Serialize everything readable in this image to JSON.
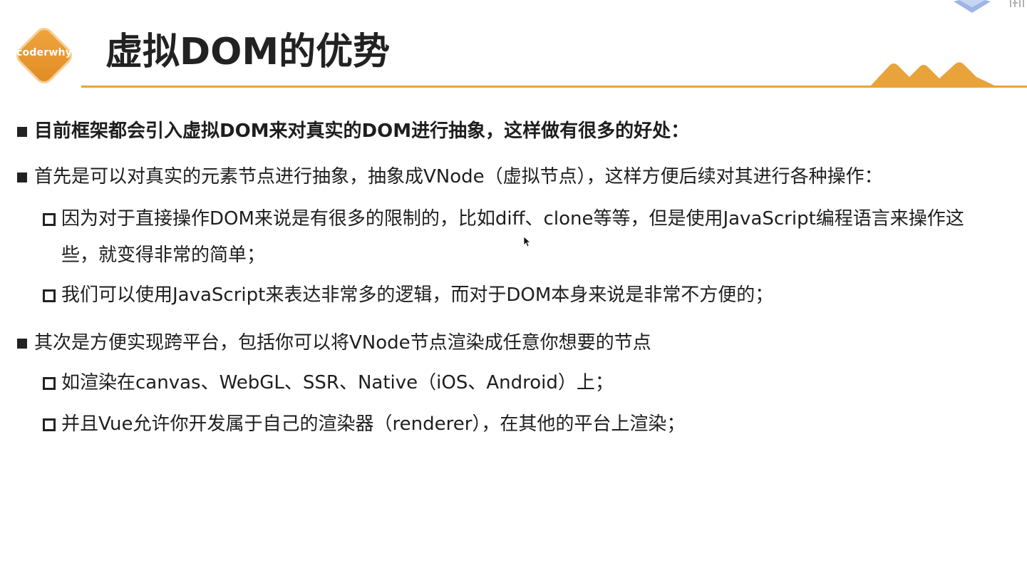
{
  "logo": {
    "text": "coderwhy",
    "color": "#e8962e"
  },
  "title": "虚拟DOM的优势",
  "accent_color": "#e8a33b",
  "bullets": [
    {
      "level": 1,
      "bold": true,
      "text": "目前框架都会引入虚拟DOM来对真实的DOM进行抽象，这样做有很多的好处："
    },
    {
      "level": 1,
      "bold": false,
      "text": "首先是可以对真实的元素节点进行抽象，抽象成VNode（虚拟节点），这样方便后续对其进行各种操作："
    },
    {
      "level": 2,
      "bold": false,
      "text": "因为对于直接操作DOM来说是有很多的限制的，比如diff、clone等等，但是使用JavaScript编程语言来操作这",
      "continuation": "些，就变得非常的简单；"
    },
    {
      "level": 2,
      "bold": false,
      "text": "我们可以使用JavaScript来表达非常多的逻辑，而对于DOM本身来说是非常不方便的；"
    },
    {
      "level": 1,
      "bold": false,
      "text": "其次是方便实现跨平台，包括你可以将VNode节点渲染成任意你想要的节点"
    },
    {
      "level": 2,
      "bold": false,
      "text": "如渲染在canvas、WebGL、SSR、Native（iOS、Android）上；"
    },
    {
      "level": 2,
      "bold": false,
      "text": "并且Vue允许你开发属于自己的渲染器（renderer），在其他的平台上渲染；"
    }
  ]
}
